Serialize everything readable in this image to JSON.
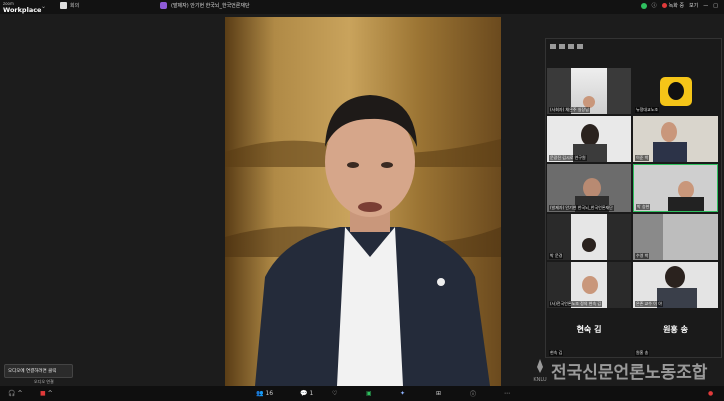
{
  "app": {
    "brand_small": "zoom",
    "brand_name": "Workplace",
    "home_label": "회의"
  },
  "meeting": {
    "title": "(발제자) 안기현 한국뇌_한국언론재단"
  },
  "topbar": {
    "record_label": "녹화 중",
    "view_label": "보기"
  },
  "gallery": {
    "tiles": [
      {
        "label": "(사회자) 채은주 실장님"
      },
      {
        "label": "뉴정대교노조"
      },
      {
        "label": "문광진 김시로 연구원"
      },
      {
        "label": "이준 박"
      },
      {
        "label": "(발제자) 안기현 한국뇌_한국언론재단"
      },
      {
        "label": "박 승현"
      },
      {
        "label": "박 문경"
      },
      {
        "label": "수영 박"
      },
      {
        "label": "(사)전국언론노조 정의 현숙 김"
      },
      {
        "label": "은존 교수 이 야"
      },
      {
        "label": "현숙 김",
        "big": "현숙 김"
      },
      {
        "label": "원홍 송",
        "big": "원홍 송"
      }
    ]
  },
  "tooltip": {
    "text": "오디오에 연결하려면 클릭",
    "sub": "오디오 연결"
  },
  "watermark": {
    "text": "전국신문언론노동조합",
    "abbr": "KNLU"
  },
  "toolbar": {
    "participants_count": "16",
    "chat_count": "1"
  },
  "colors": {
    "accent_green": "#2fbf5f",
    "record_red": "#e03a3a",
    "brand_purple": "#8e5bd8"
  }
}
